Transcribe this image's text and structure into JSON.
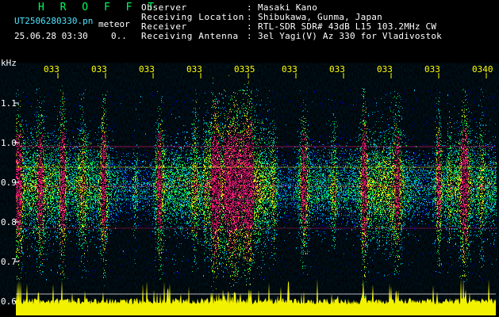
{
  "header": {
    "title": "H R O F F T",
    "filename": "UT2506280330.pn",
    "event_type": "meteor",
    "date_time": "25.06.28 03:30",
    "count": "0.."
  },
  "station_info": [
    {
      "label": "Observer",
      "value": "Masaki Kano"
    },
    {
      "label": "Receiving Location",
      "value": "Shibukawa, Gunma, Japan"
    },
    {
      "label": "Receiver",
      "value": "RTL-SDR SDR# 43dB L15 103.2MHz CW"
    },
    {
      "label": "Receiving Antenna",
      "value": "3el Yagi(V) Az 330 for Vladivostok"
    }
  ],
  "axis": {
    "y_unit": "kHz",
    "y_ticks": [
      "1.1",
      "1.0",
      "0.9",
      "0.8",
      "0.7",
      "0.6"
    ],
    "time_ticks": [
      "033",
      "033",
      "033",
      "033",
      "0335",
      "033",
      "033",
      "033",
      "033",
      "0340"
    ]
  },
  "colors": {
    "background": "#000000",
    "low_signal": "#0000a8",
    "mid_signal": "#00bfff",
    "high_signal": "#00ff5a",
    "very_high_signal": "#ffff00",
    "peak_signal": "#ff1a7a",
    "activity_trace": "#ffff00",
    "label": "#ffffff",
    "title": "#00ff5a",
    "filename": "#4de6ff"
  }
}
